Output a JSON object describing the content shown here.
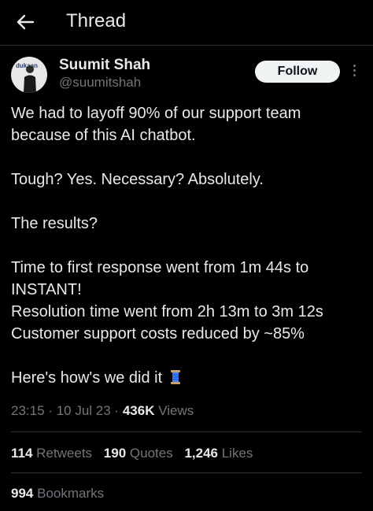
{
  "header": {
    "title": "Thread",
    "back_icon": "arrow-left-icon"
  },
  "author": {
    "name": "Suumit Shah",
    "handle": "@suumitshah",
    "avatar_logo_text": "dukaan"
  },
  "follow_label": "Follow",
  "post": {
    "paragraphs": [
      [
        "We had to layoff 90% of our support team",
        "because of this AI chatbot."
      ],
      [
        "Tough? Yes. Necessary? Absolutely."
      ],
      [
        "The results?"
      ],
      [
        "Time to first response went from 1m 44s to",
        "INSTANT!",
        "Resolution time went from 2h 13m to 3m 12s",
        "Customer support costs reduced by ~85%"
      ],
      [
        "Here's how's we did it"
      ]
    ],
    "emoji": "thread-spool-icon"
  },
  "meta": {
    "time": "23:15",
    "date": "10 Jul 23",
    "views_count": "436K",
    "views_label": "Views",
    "separator": "·"
  },
  "stats": {
    "retweets_count": "114",
    "retweets_label": "Retweets",
    "quotes_count": "190",
    "quotes_label": "Quotes",
    "likes_count": "1,246",
    "likes_label": "Likes",
    "bookmarks_count": "994",
    "bookmarks_label": "Bookmarks"
  },
  "colors": {
    "background": "#000000",
    "text": "#e7e9ea",
    "muted": "#71767b",
    "divider": "#2f3336",
    "button": "#eff3f4"
  }
}
